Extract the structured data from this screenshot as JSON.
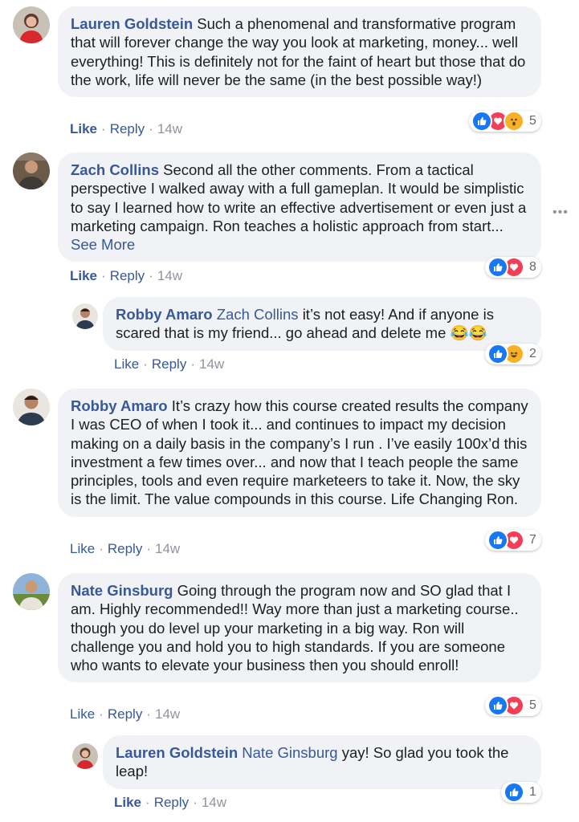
{
  "colors": {
    "link": "#385898",
    "bubble": "#f0f2f5",
    "meta": "#90949c",
    "like_reaction": "#1877f2",
    "love_reaction": "#f33e58",
    "wow_reaction": "#f7b125"
  },
  "comments": [
    {
      "author": "Lauren Goldstein",
      "text": "Such a phenomenal and transformative program that will forever change the way you look at marketing, money... well everything! This is definitely not for the faint of heart but those that do the work, life will never be the same (in the best possible way!)",
      "like": "Like",
      "reply": "Reply",
      "time": "14w",
      "reaction_count": "5",
      "reactions": [
        "like-icon",
        "love-icon",
        "wow-icon"
      ]
    },
    {
      "author": "Zach Collins",
      "text": "Second all the other comments. From a tactical perspective I walked away with a full gameplan. It would be simplistic to say I learned how to write an effective advertisement or even just a marketing campaign. Ron teaches a holistic approach from start...",
      "see_more": "See More",
      "like": "Like",
      "reply": "Reply",
      "time": "14w",
      "reaction_count": "8",
      "reactions": [
        "like-icon",
        "love-icon"
      ]
    },
    {
      "author": "Robby Amaro",
      "mention": "Zach Collins",
      "text": "it’s not easy! And if anyone is scared that is my friend... go ahead and delete me 😂😂",
      "like": "Like",
      "reply": "Reply",
      "time": "14w",
      "reaction_count": "2",
      "reactions": [
        "like-icon",
        "haha-icon"
      ]
    },
    {
      "author": "Robby Amaro",
      "text": "It’s crazy how this course created results the company I was CEO of when I took it... and continues to impact my decision making on a daily basis in the company’s I run . I’ve easily 100x’d this investment a few times over... and now that I teach people the same principles, tools and even require marketeers to take it. Now, the sky is the limit. The value compounds in this course. Life Changing Ron.",
      "like": "Like",
      "reply": "Reply",
      "time": "14w",
      "reaction_count": "7",
      "reactions": [
        "like-icon",
        "love-icon"
      ]
    },
    {
      "author": "Nate Ginsburg",
      "text": "Going through the program now and SO glad that I am. Highly recommended!! Way more than just a marketing course.. though you do level up your marketing in a big way. Ron will challenge you and hold you to high standards. If you are someone who wants to elevate your business then you should enroll!",
      "like": "Like",
      "reply": "Reply",
      "time": "14w",
      "reaction_count": "5",
      "reactions": [
        "like-icon",
        "love-icon"
      ]
    },
    {
      "author": "Lauren Goldstein",
      "mention": "Nate Ginsburg",
      "text": "yay! So glad you took the leap!",
      "like": "Like",
      "reply": "Reply",
      "time": "14w",
      "reaction_count": "1",
      "reactions": [
        "like-icon"
      ]
    }
  ],
  "more_options_icon": "more-horizontal-icon"
}
